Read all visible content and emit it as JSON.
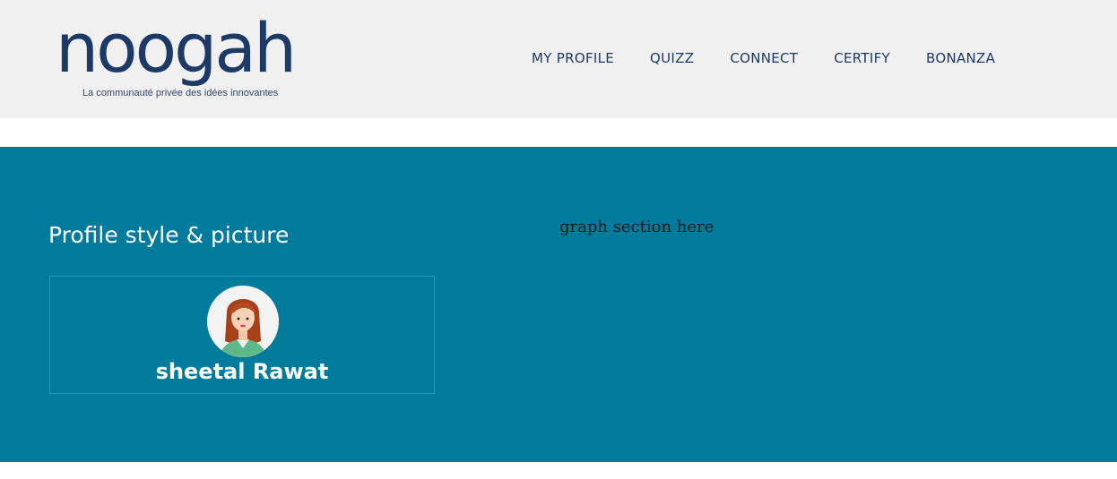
{
  "header": {
    "logo_text": "noogah",
    "tagline": "La communauté privée des idées innovantes",
    "nav": [
      {
        "label": "MY PROFILE"
      },
      {
        "label": "QUIZZ"
      },
      {
        "label": "CONNECT"
      },
      {
        "label": "CERTIFY"
      },
      {
        "label": "BONANZA"
      }
    ]
  },
  "profile": {
    "section_title": "Profile style & picture",
    "name": "sheetal Rawat"
  },
  "graph": {
    "placeholder": "graph section here"
  },
  "colors": {
    "header_bg": "#f0f0f0",
    "brand_navy": "#1d3a66",
    "band_bg": "#017b9c",
    "card_border": "#1b9bbd"
  }
}
